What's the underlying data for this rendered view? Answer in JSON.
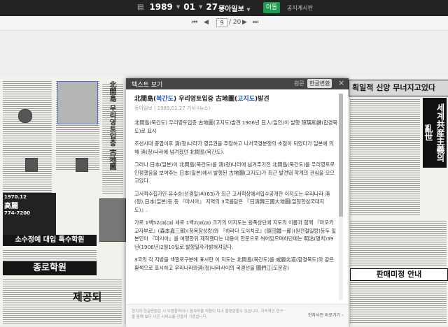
{
  "toolbar": {
    "year": "1989",
    "month": "01",
    "day": "27",
    "newspaper": "동아일보",
    "go_label": "이동",
    "notice_label": "공지게시판"
  },
  "pager": {
    "current_page": "9",
    "total_pages": "/ 20"
  },
  "modal": {
    "title": "텍스트 보기",
    "tab_original": "원문",
    "tab_hangul": "한글변환",
    "close_label": "×",
    "article_title_parts": [
      "北間島(",
      "북간도",
      ") 우리영토입증 古地圖(",
      "고지도",
      ")발견"
    ],
    "meta": "동아일보 | 1989.01.27 기사 (뉴스)",
    "paragraphs": [
      "北間島(북간도) 우리영토입증 古地圖(고지도)발견 1906년 日人(일인)이 발행 琅璃和讃(합경북도)로 표시",
      "조선시대 중엽이후 淸(청)나라가 영유권을 주장하고 나서국경분쟁의 초점이 되었다가 일본에 의해 淸(청)나라에 넘겨졌던 北間島(북간도).",
      "그러나 日本(일본)이 北間島(북간도)를 淸(청)나라에 넘겨주기전 北間島(북간도)를 우리영토로 인정했음을 보여주는 日本(일본)에서 발행된 古地圖(고지도)가 최근 발견돼 학계의 관심을 모으고있다.",
      "고서적수집가인 유수승(선경일)씨(63)가 최근 고서적상에서입수공개한 이지도는 우리나라 淸(청),日本(일본)등 등 『마시아』 지역의 3국를담은 『日淸韓三國大地圖(일청한삼국대지도)』.",
      "가로 1백52㎝(㎝) 세로 1백2㎝(㎝) 크기의 이지도는 원폭상단에 지도의 이름과 함께 『마오카 교자부로』(森本嘉三郞)(청목장상랑)와 『하라다 도이치로』(原田鐵一郞)(원전철일랑)등두 일본인이 『마시아』를 여행한뒤 제작했다는 내용이 한문으로 씌어있으며하단에는 明治(명치)39년(1906년)2월10일로 발행일자가밝혀져있다.",
      "3국의 각 지방을 색깔로구분해 표시한 이 지도는 北間島(북간도)를 咸鏡北道(함경북도)와 같은 황색으로 표시하고 우리나라와淸(청)나라사이의 국경선을 圖們江(도문강)"
    ],
    "footer_note": "현지의 한글변환은 시 무용할띄어나 음자마을 적용이 다소 불편판할수 있습니다. 지속적인 연구을 통해 보다 나은 서비스를 만들어 가겠습니다.",
    "footer_link": "한자사전 바로가기 ›"
  },
  "newspaper": {
    "headline_1": "획일적 신앙 무너지고있다",
    "headline_2": "세계共産主義의 亂世",
    "headline_3": "北間島 우리영토입증 古地圖",
    "ad_1": "소수정예 대입 특수학원",
    "ad_2": "종로학원",
    "ad_3": "판매미정 안내",
    "ad_4": "제공되",
    "ad_5": "高麗",
    "ad_6": "774-7200",
    "ad_7": "1970.12"
  }
}
